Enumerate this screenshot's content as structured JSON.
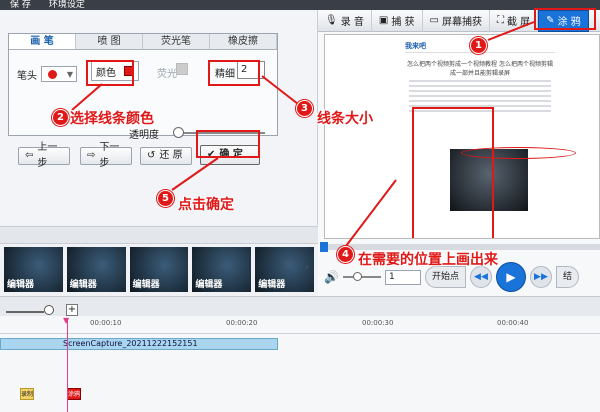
{
  "topbar": {
    "items": [
      "保 存",
      "环境设定"
    ]
  },
  "brush_tabs": [
    "画 笔",
    "喷 图",
    "荧光笔",
    "橡皮擦"
  ],
  "brush": {
    "head_label": "笔头",
    "color_label": "颜色",
    "highlighter_label": "荧光",
    "thickness_label": "精细",
    "thickness_value": "2",
    "alpha_label": "透明度"
  },
  "buttons": {
    "undo": "上一步",
    "redo": "下一步",
    "restore": "还 原",
    "ok": "确 定"
  },
  "thumbs": [
    "编辑器",
    "编辑器",
    "编辑器",
    "编辑器",
    "编辑器"
  ],
  "right_toolbar": {
    "record": "录 音",
    "capture": "捕 获",
    "screen_capture": "屏幕捕获",
    "screenshot": "截 屏",
    "graffiti": "涂 鸦"
  },
  "doc": {
    "brand": "我来吧",
    "title": "怎么把两个视频剪成一个视频教程 怎么把两个视频剪辑成一部并且能剪辑录屏"
  },
  "player": {
    "page_value": "1",
    "start_label": "开始点",
    "end_label": "结"
  },
  "timeline": {
    "ticks": [
      "00:00:10",
      "00:00:20",
      "00:00:30",
      "00:00:40"
    ],
    "clip_name": "ScreenCapture_20211222152151",
    "marks": [
      "录制",
      "涂鸦"
    ]
  },
  "annotations": {
    "badges": [
      "1",
      "2",
      "3",
      "4",
      "5"
    ],
    "step2": "选择线条颜色",
    "step3": "线条大小",
    "step4": "在需要的位置上画出来",
    "step5": "点击确定"
  },
  "colors": {
    "accent": "#1a73d9",
    "annotation": "#e01818"
  }
}
